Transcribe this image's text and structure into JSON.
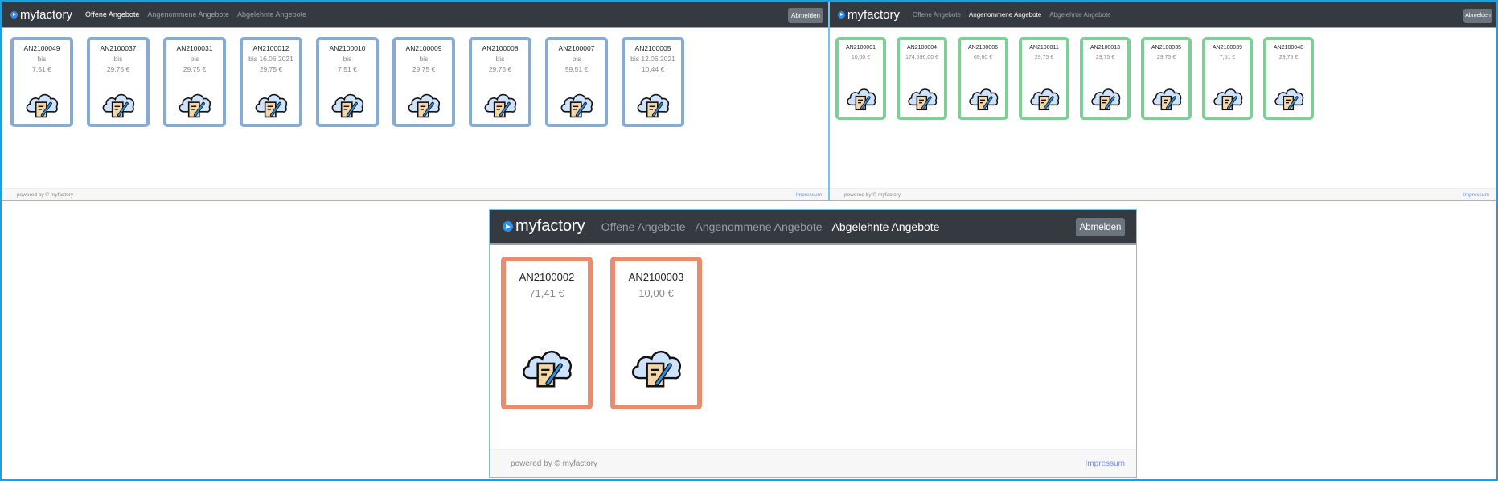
{
  "brand": "myfactory",
  "panels": [
    {
      "nav": [
        "Offene Angebote",
        "Angenommene Angebote",
        "Abgelehnte Angebote"
      ],
      "active": 0,
      "logout": "Abmelden",
      "footer_left": "powered by © myfactory",
      "footer_right": "Impressum",
      "cards": [
        {
          "number": "AN2100049",
          "lines": [
            "bis",
            "7,51 €"
          ]
        },
        {
          "number": "AN2100037",
          "lines": [
            "bis",
            "29,75 €"
          ]
        },
        {
          "number": "AN2100031",
          "lines": [
            "bis",
            "29,75 €"
          ]
        },
        {
          "number": "AN2100012",
          "lines": [
            "bis 16.06.2021",
            "29,75 €"
          ]
        },
        {
          "number": "AN2100010",
          "lines": [
            "bis",
            "7,51 €"
          ]
        },
        {
          "number": "AN2100009",
          "lines": [
            "bis",
            "29,75 €"
          ]
        },
        {
          "number": "AN2100008",
          "lines": [
            "bis",
            "29,75 €"
          ]
        },
        {
          "number": "AN2100007",
          "lines": [
            "bis",
            "59,51 €"
          ]
        },
        {
          "number": "AN2100005",
          "lines": [
            "bis 12.06.2021",
            "10,44 €"
          ]
        }
      ]
    },
    {
      "nav": [
        "Offene Angebote",
        "Angenommene Angebote",
        "Abgelehnte Angebote"
      ],
      "active": 1,
      "logout": "Abmelden",
      "footer_left": "powered by © myfactory",
      "footer_right": "Impressum",
      "cards": [
        {
          "number": "AN2100001",
          "lines": [
            "10,00 €"
          ]
        },
        {
          "number": "AN2100004",
          "lines": [
            "174.696,00 €"
          ]
        },
        {
          "number": "AN2100006",
          "lines": [
            "69,60 €"
          ]
        },
        {
          "number": "AN2100011",
          "lines": [
            "29,75 €"
          ]
        },
        {
          "number": "AN2100013",
          "lines": [
            "29,75 €"
          ]
        },
        {
          "number": "AN2100035",
          "lines": [
            "29,75 €"
          ]
        },
        {
          "number": "AN2100039",
          "lines": [
            "7,51 €"
          ]
        },
        {
          "number": "AN2100048",
          "lines": [
            "29,75 €"
          ]
        }
      ]
    },
    {
      "nav": [
        "Offene Angebote",
        "Angenommene Angebote",
        "Abgelehnte Angebote"
      ],
      "active": 2,
      "logout": "Abmelden",
      "footer_left": "powered by © myfactory",
      "footer_right": "Impressum",
      "cards": [
        {
          "number": "AN2100002",
          "lines": [
            "71,41 €"
          ]
        },
        {
          "number": "AN2100003",
          "lines": [
            "10,00 €"
          ]
        }
      ]
    }
  ],
  "colors": {
    "open": "#86acd4",
    "accepted": "#7fcd97",
    "rejected": "#e88b6f",
    "navbar": "#343a40"
  }
}
